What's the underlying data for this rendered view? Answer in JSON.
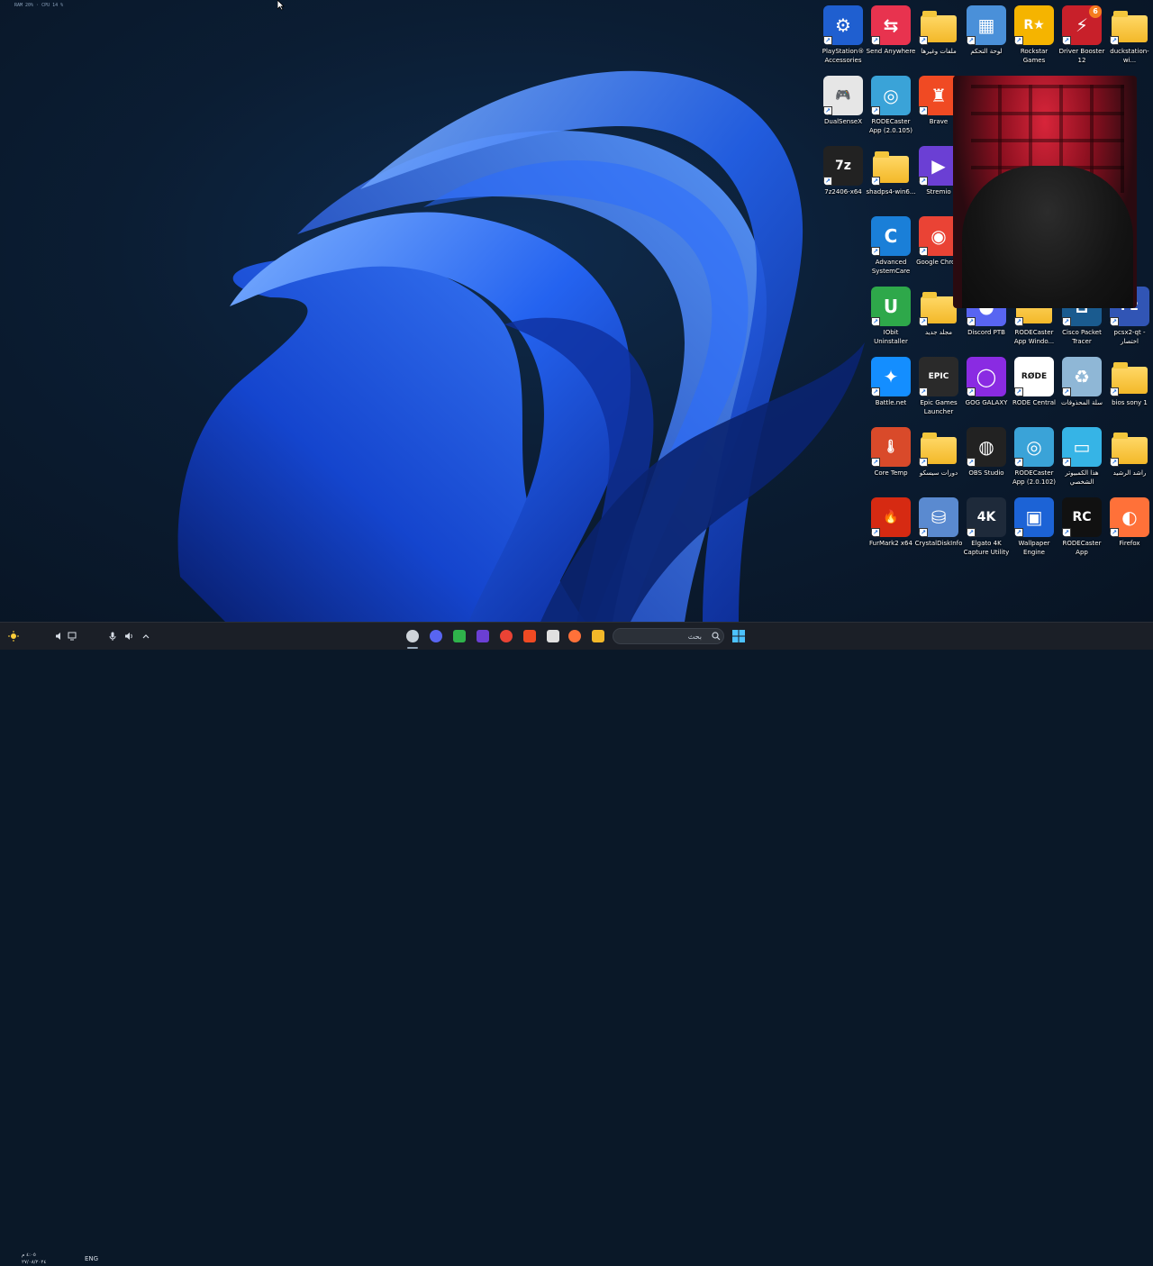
{
  "desktop": {
    "perf_overlay": "RAM 20% · CPU 14 %",
    "icons": [
      {
        "id": "ps-accessories",
        "label": "PlayStation® Accessories",
        "icon": "gamepad-gear-icon",
        "color": "#1f5fd0"
      },
      {
        "id": "send-anywhere",
        "label": "Send Anywhere",
        "icon": "send-anywhere-icon",
        "color": "#e8334f"
      },
      {
        "id": "files-folder",
        "label": "ملفات وغيرها",
        "icon": "folder-icon",
        "color": "#f3b829"
      },
      {
        "id": "control-panel",
        "label": "لوحة التحكم",
        "icon": "control-panel-icon",
        "color": "#4a90d9"
      },
      {
        "id": "rockstar",
        "label": "Rockstar Games Launcher",
        "icon": "rockstar-icon",
        "color": "#f5b400"
      },
      {
        "id": "driver-booster",
        "label": "Driver Booster 12",
        "icon": "driver-booster-icon",
        "color": "#c8202a",
        "badge": "6"
      },
      {
        "id": "duckstation",
        "label": "duckstation-wi...",
        "icon": "folder-icon",
        "color": "#f3b829"
      },
      {
        "id": "dualsensex",
        "label": "DualSenseX",
        "icon": "controller-icon",
        "color": "#e6e6e6"
      },
      {
        "id": "rodecaster-2105",
        "label": "RODECaster App (2.0.105)",
        "icon": "cd-installer-icon",
        "color": "#3aa3d8"
      },
      {
        "id": "brave",
        "label": "Brave",
        "icon": "brave-lion-icon",
        "color": "#f04a23"
      },
      {
        "id": "7z",
        "label": "7z2406-x64",
        "icon": "7zip-icon",
        "color": "#222"
      },
      {
        "id": "shadps4",
        "label": "shadps4-win6...",
        "icon": "folder-icon",
        "color": "#f3b829"
      },
      {
        "id": "stremio",
        "label": "Stremio",
        "icon": "stremio-play-icon",
        "color": "#6b3fd4"
      },
      {
        "id": "advanced-systemcare",
        "label": "Advanced SystemCare",
        "icon": "systemcare-icon",
        "color": "#1a7fd8"
      },
      {
        "id": "google-chrome",
        "label": "Google Chro...",
        "icon": "chrome-icon",
        "color": "#ea4335"
      },
      {
        "id": "iobit-uninstaller",
        "label": "IObit Uninstaller",
        "icon": "uninstaller-icon",
        "color": "#2ea84a"
      },
      {
        "id": "new-folder",
        "label": "مجلد جديد",
        "icon": "folder-icon",
        "color": "#f3b829"
      },
      {
        "id": "discord-ptb",
        "label": "Discord PTB",
        "icon": "discord-icon",
        "color": "#5865f2"
      },
      {
        "id": "rodecaster-window",
        "label": "RODECaster App Windo...",
        "icon": "folder-icon",
        "color": "#f3b829"
      },
      {
        "id": "cisco-packet",
        "label": "Cisco Packet Tracer",
        "icon": "cisco-icon",
        "color": "#1a5b8f"
      },
      {
        "id": "pcsx2",
        "label": "pcsx2-qt - اختصار",
        "icon": "pcsx2-icon",
        "color": "#3155b5"
      },
      {
        "id": "battle-net",
        "label": "Battle.net",
        "icon": "battlenet-icon",
        "color": "#148eff"
      },
      {
        "id": "epic-games",
        "label": "Epic Games Launcher",
        "icon": "epic-games-icon",
        "color": "#2a2a2a"
      },
      {
        "id": "gog-galaxy",
        "label": "GOG GALAXY",
        "icon": "gog-ring-icon",
        "color": "#8a2be2"
      },
      {
        "id": "rode-central",
        "label": "RODE Central",
        "icon": "rode-icon",
        "color": "#ffffff"
      },
      {
        "id": "recycle-bin",
        "label": "سلة المحذوفات",
        "icon": "recycle-bin-icon",
        "color": "#8fb7d6"
      },
      {
        "id": "bios-sony",
        "label": "bios sony 1",
        "icon": "folder-icon",
        "color": "#f3b829"
      },
      {
        "id": "core-temp",
        "label": "Core Temp",
        "icon": "thermometer-icon",
        "color": "#d94a2a"
      },
      {
        "id": "cisco-courses",
        "label": "دورات سيسكو",
        "icon": "folder-icon",
        "color": "#f3b829"
      },
      {
        "id": "obs-studio",
        "label": "OBS Studio",
        "icon": "obs-icon",
        "color": "#222"
      },
      {
        "id": "rodecaster-2102",
        "label": "RODECaster App (2.0.102)",
        "icon": "cd-installer-icon",
        "color": "#3aa3d8"
      },
      {
        "id": "this-pc",
        "label": "هذا الكمبيوتر الشخصي",
        "icon": "monitor-icon",
        "color": "#36b4e6"
      },
      {
        "id": "rashid",
        "label": "راشد الرشيد",
        "icon": "user-folder-icon",
        "color": "#f3b829"
      },
      {
        "id": "furmark",
        "label": "FurMark2 x64",
        "icon": "furmark-flame-icon",
        "color": "#d62a12"
      },
      {
        "id": "crystaldisk",
        "label": "CrystalDiskInfo",
        "icon": "crystaldisk-icon",
        "color": "#5a8ad0"
      },
      {
        "id": "elgato-4k",
        "label": "Elgato 4K Capture Utility",
        "icon": "elgato-4k-icon",
        "color": "#1e2a3a"
      },
      {
        "id": "wallpaper-engine",
        "label": "Wallpaper Engine",
        "icon": "wallpaper-engine-icon",
        "color": "#1c63d6"
      },
      {
        "id": "rodecaster-app",
        "label": "RODECaster App",
        "icon": "rodecaster-app-icon",
        "color": "#111"
      },
      {
        "id": "firefox",
        "label": "Firefox",
        "icon": "firefox-icon",
        "color": "#ff7139"
      }
    ]
  },
  "taskbar": {
    "search_placeholder": "بحث",
    "lang": "ENG",
    "clock_time": "٤:٠٥ م",
    "clock_date": "٢٧/٠٨/٢٠٢٤",
    "apps": [
      {
        "id": "obs",
        "icon": "obs-icon",
        "color": "#cfd4da"
      },
      {
        "id": "discord",
        "icon": "discord-icon",
        "color": "#5865f2"
      },
      {
        "id": "app-green",
        "icon": "play-green-icon",
        "color": "#2fb34b"
      },
      {
        "id": "stremio",
        "icon": "stremio-play-icon",
        "color": "#6b3fd4"
      },
      {
        "id": "chrome",
        "icon": "chrome-icon",
        "color": "#ea4335"
      },
      {
        "id": "brave",
        "icon": "brave-lion-icon",
        "color": "#f04a23"
      },
      {
        "id": "calculator",
        "icon": "calculator-icon",
        "color": "#e0e0e0"
      },
      {
        "id": "firefox",
        "icon": "firefox-icon",
        "color": "#ff7139"
      },
      {
        "id": "explorer",
        "icon": "folder-icon",
        "color": "#f3b829"
      }
    ]
  }
}
